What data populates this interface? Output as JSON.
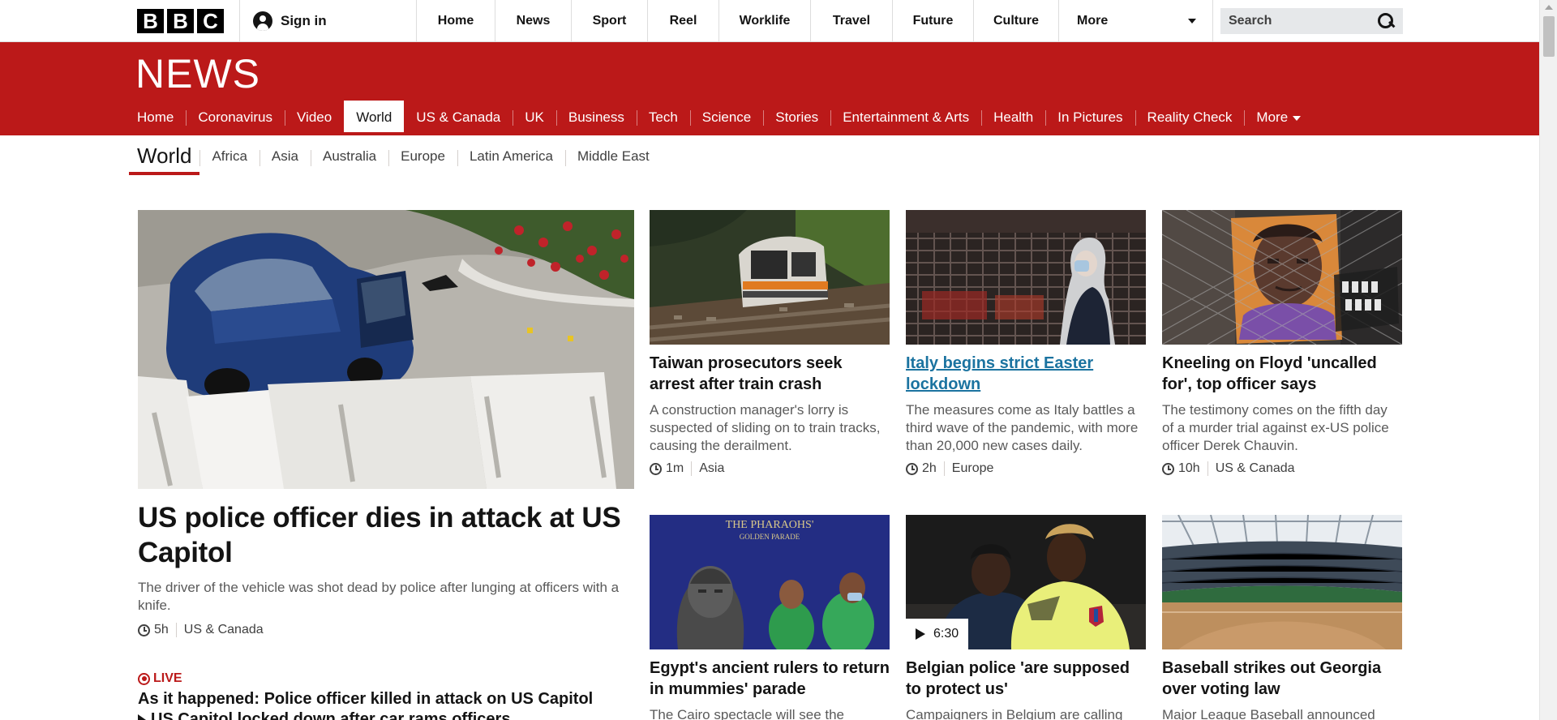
{
  "topbar": {
    "logo_letters": [
      "B",
      "B",
      "C"
    ],
    "signin_label": "Sign in",
    "nav": [
      "Home",
      "News",
      "Sport",
      "Reel",
      "Worklife",
      "Travel",
      "Future",
      "Culture"
    ],
    "more_label": "More",
    "search_placeholder": "Search"
  },
  "news": {
    "logo": "NEWS",
    "nav": [
      "Home",
      "Coronavirus",
      "Video",
      "World",
      "US & Canada",
      "UK",
      "Business",
      "Tech",
      "Science",
      "Stories",
      "Entertainment & Arts",
      "Health",
      "In Pictures",
      "Reality Check"
    ],
    "active": "World",
    "more_label": "More"
  },
  "section": {
    "title": "World",
    "items": [
      "Africa",
      "Asia",
      "Australia",
      "Europe",
      "Latin America",
      "Middle East"
    ]
  },
  "hero": {
    "headline": "US police officer dies in attack at US Capitol",
    "summary": "The driver of the vehicle was shot dead by police after lunging at officers with a knife.",
    "time": "5h",
    "tag": "US & Canada"
  },
  "live": {
    "label": "LIVE",
    "headline": "As it happened: Police officer killed in attack on US Capitol",
    "sub": "US Capitol locked down after car rams officers"
  },
  "cards": [
    {
      "headline": "Taiwan prosecutors seek arrest after train crash",
      "summary": "A construction manager's lorry is suspected of sliding on to train tracks, causing the derailment.",
      "time": "1m",
      "tag": "Asia"
    },
    {
      "headline": "Italy begins strict Easter lockdown",
      "summary": "The measures come as Italy battles a third wave of the pandemic, with more than 20,000 new cases daily.",
      "time": "2h",
      "tag": "Europe"
    },
    {
      "headline": "Kneeling on Floyd 'uncalled for', top officer says",
      "summary": "The testimony comes on the fifth day of a murder trial against ex-US police officer Derek Chauvin.",
      "time": "10h",
      "tag": "US & Canada"
    },
    {
      "headline": "Egypt's ancient rulers to return in mummies' parade",
      "summary": "The Cairo spectacle will see the"
    },
    {
      "headline": "Belgian police 'are supposed to protect us'",
      "summary": "Campaigners in Belgium are calling",
      "video_duration": "6:30"
    },
    {
      "headline": "Baseball strikes out Georgia over voting law",
      "summary": "Major League Baseball announced"
    }
  ],
  "images": {
    "pharaohs_sign": "THE PHARAOHS'",
    "pharaohs_sign_sub": "GOLDEN PARADE"
  },
  "colors": {
    "brand_red": "#bb1919",
    "link_blue": "#1b73a0"
  }
}
